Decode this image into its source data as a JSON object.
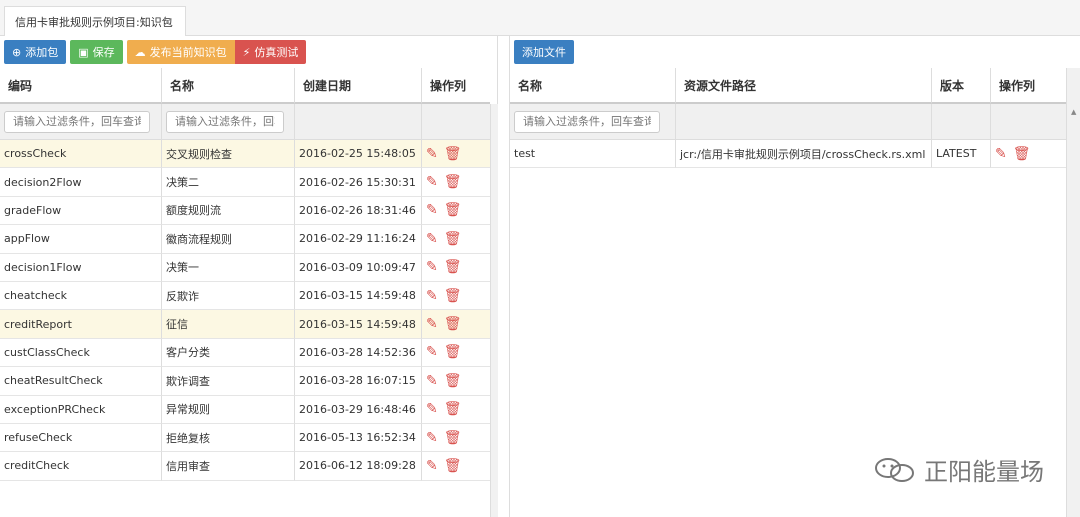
{
  "tab": {
    "title": "信用卡审批规则示例项目:知识包",
    "close": "×"
  },
  "left": {
    "toolbar": {
      "add": "添加包",
      "save": "保存",
      "publish": "发布当前知识包",
      "simulate": "仿真测试"
    },
    "columns": [
      "编码",
      "名称",
      "创建日期",
      "操作列"
    ],
    "filter_placeholder_1": "请输入过滤条件，回车查询",
    "filter_placeholder_2": "请输入过滤条件，回车查询",
    "rows": [
      {
        "code": "crossCheck",
        "name": "交叉规则检查",
        "date": "2016-02-25 15:48:05"
      },
      {
        "code": "decision2Flow",
        "name": "决策二",
        "date": "2016-02-26 15:30:31"
      },
      {
        "code": "gradeFlow",
        "name": "额度规则流",
        "date": "2016-02-26 18:31:46"
      },
      {
        "code": "appFlow",
        "name": "徽商流程规则",
        "date": "2016-02-29 11:16:24"
      },
      {
        "code": "decision1Flow",
        "name": "决策一",
        "date": "2016-03-09 10:09:47"
      },
      {
        "code": "cheatcheck",
        "name": "反欺诈",
        "date": "2016-03-15 14:59:48"
      },
      {
        "code": "creditReport",
        "name": "征信",
        "date": "2016-03-15 14:59:48"
      },
      {
        "code": "custClassCheck",
        "name": "客户分类",
        "date": "2016-03-28 14:52:36"
      },
      {
        "code": "cheatResultCheck",
        "name": "欺诈调查",
        "date": "2016-03-28 16:07:15"
      },
      {
        "code": "exceptionPRCheck",
        "name": "异常规则",
        "date": "2016-03-29 16:48:46"
      },
      {
        "code": "refuseCheck",
        "name": "拒绝复核",
        "date": "2016-05-13 16:52:34"
      },
      {
        "code": "creditCheck",
        "name": "信用审查",
        "date": "2016-06-12 18:09:28"
      }
    ]
  },
  "right": {
    "toolbar": {
      "add_file": "添加文件"
    },
    "columns": [
      "名称",
      "资源文件路径",
      "版本",
      "操作列"
    ],
    "filter_placeholder": "请输入过滤条件，回车查询",
    "rows": [
      {
        "name": "test",
        "path": "jcr:/信用卡审批规则示例项目/crossCheck.rs.xml",
        "version": "LATEST"
      }
    ]
  },
  "watermark": {
    "text": "正阳能量场"
  },
  "colors": {
    "primary": "#3a7fc1",
    "success": "#5cb85c",
    "warning": "#f0ad4e",
    "danger": "#d9534f",
    "highlight": "#fcf8e3"
  }
}
